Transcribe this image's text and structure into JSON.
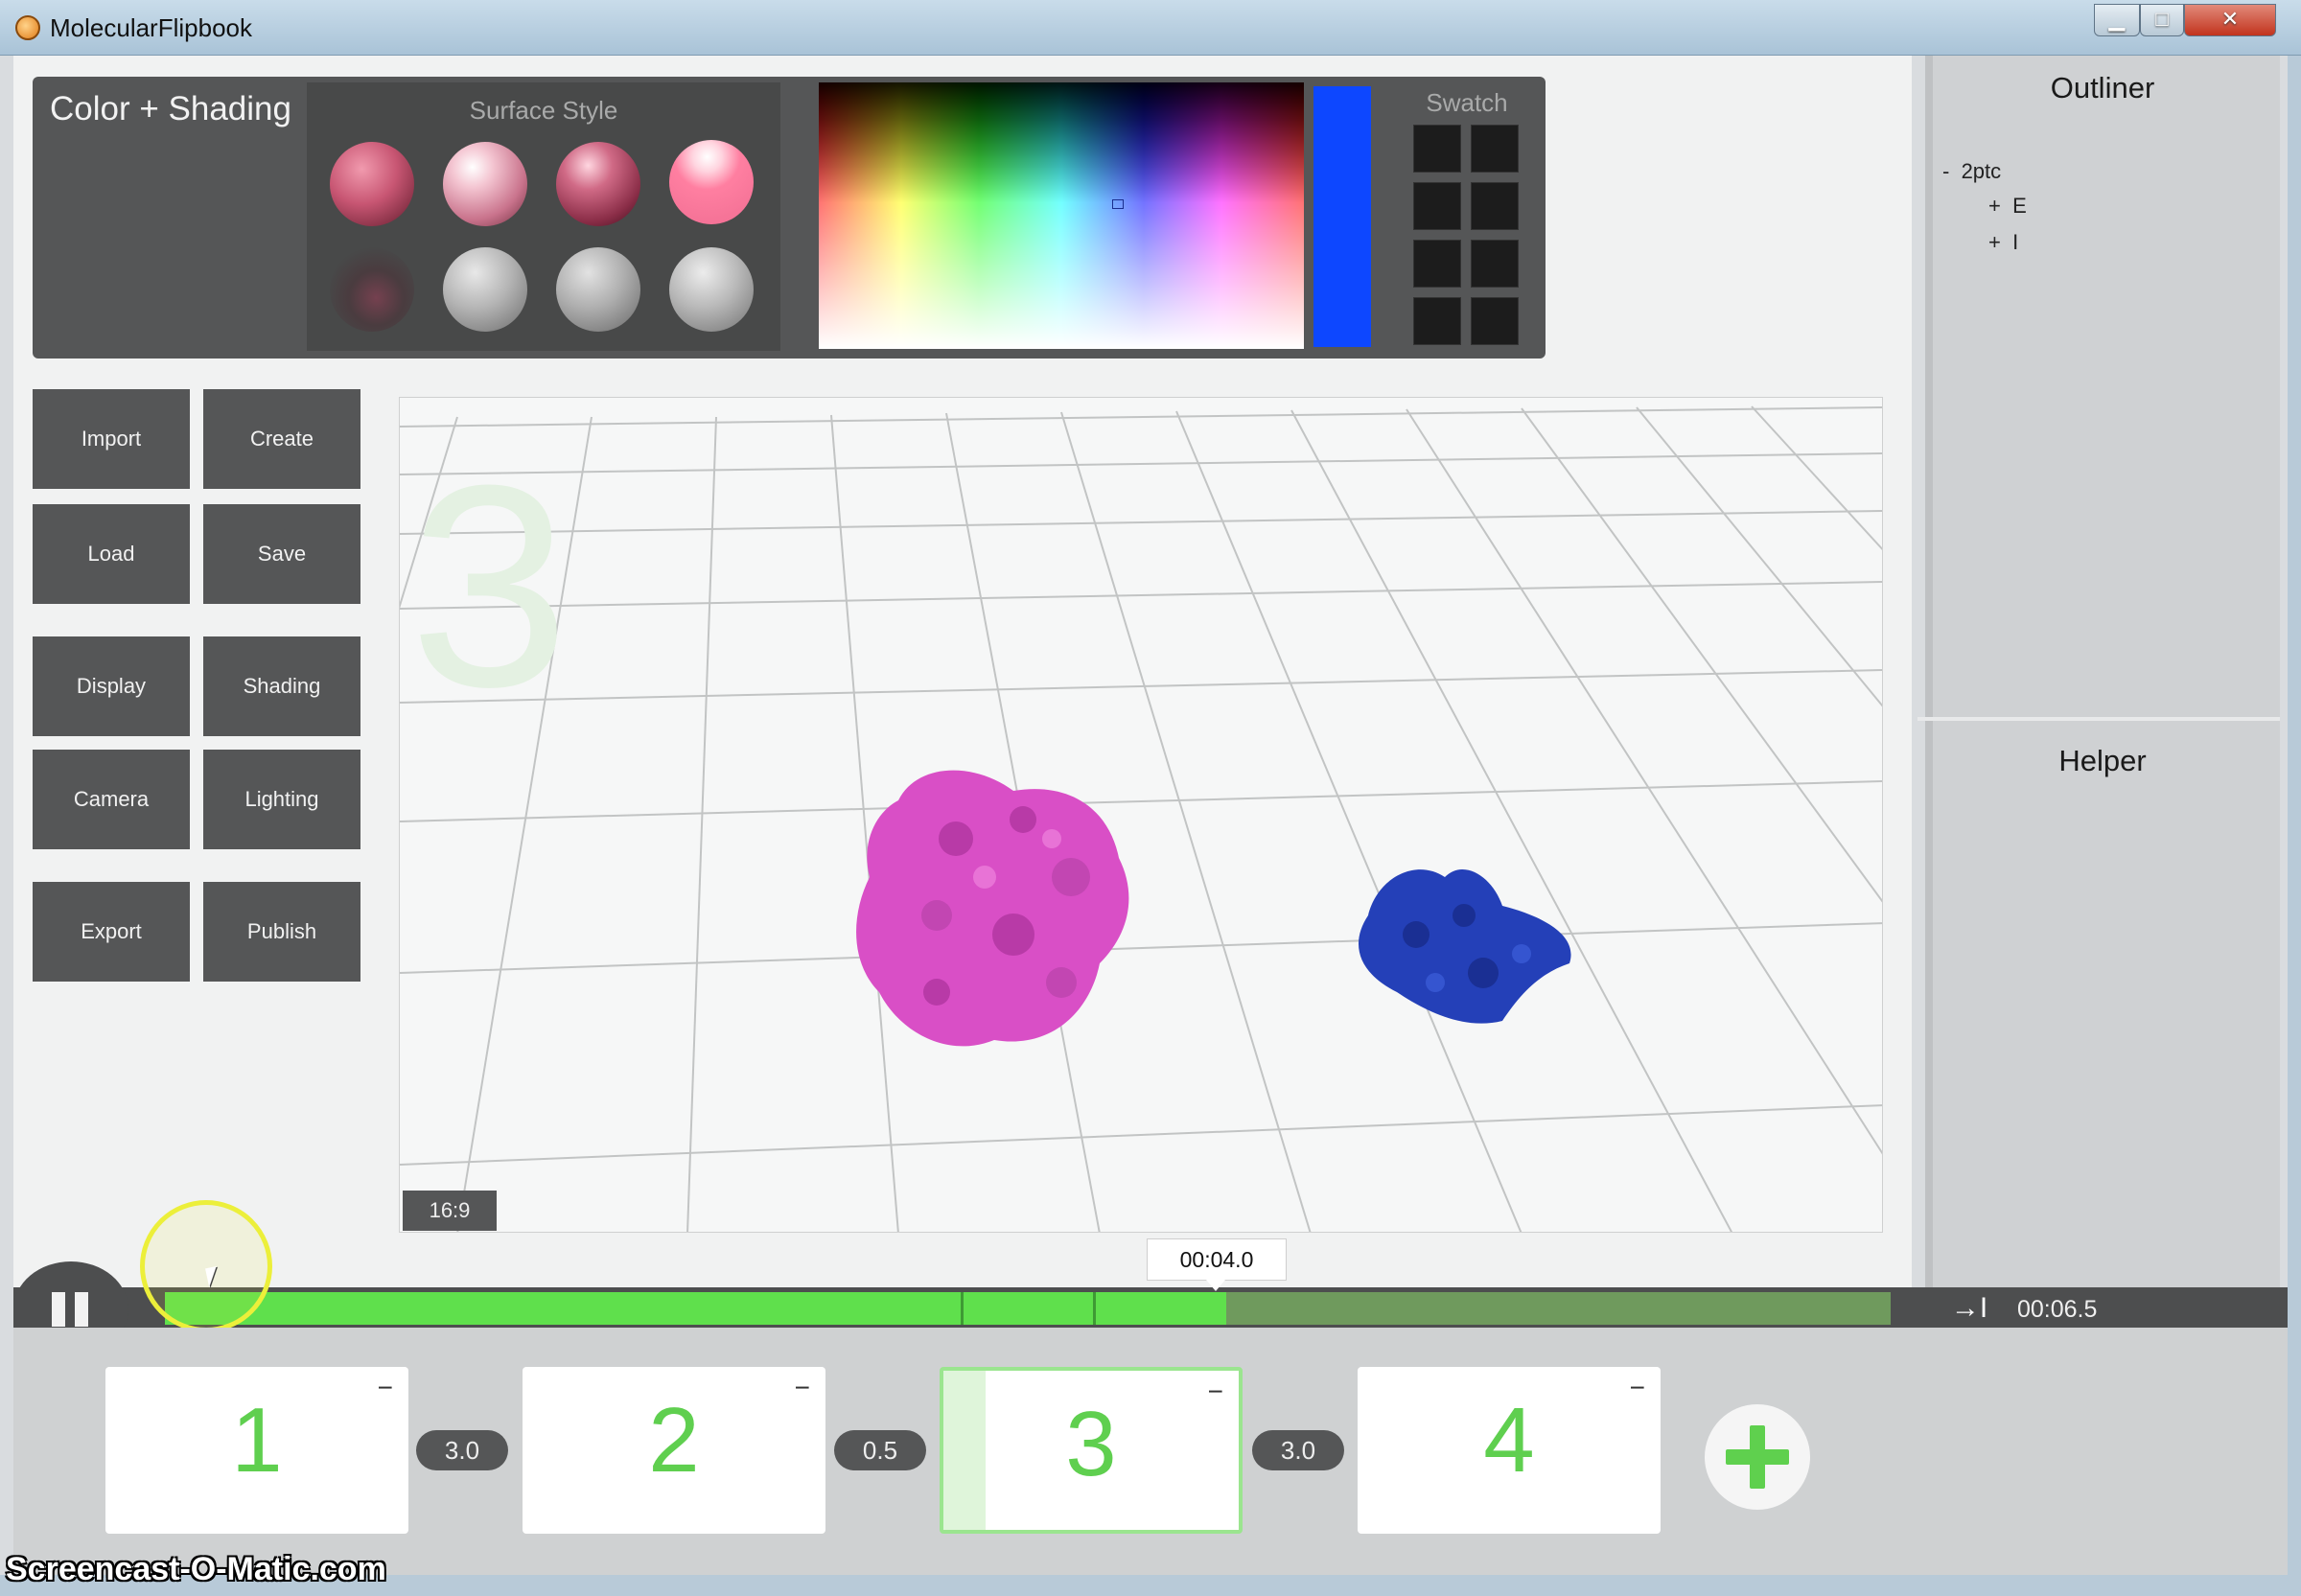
{
  "window": {
    "title": "MolecularFlipbook",
    "minimize": "▁",
    "maximize": "□",
    "close": "✕"
  },
  "color_panel": {
    "title": "Color + Shading",
    "surface_style_label": "Surface Style",
    "swatch_label": "Swatch",
    "selected_color": "#0d47ff"
  },
  "tools": {
    "import": "Import",
    "create": "Create",
    "load": "Load",
    "save": "Save",
    "display": "Display",
    "shading": "Shading",
    "camera": "Camera",
    "lighting": "Lighting",
    "export": "Export",
    "publish": "Publish"
  },
  "viewport": {
    "aspect_ratio": "16:9",
    "molecule_colors": [
      "#d94fc6",
      "#2440b8"
    ]
  },
  "outliner": {
    "title": "Outliner",
    "tree": [
      {
        "toggle": "-",
        "label": "2ptc"
      },
      {
        "toggle": "+",
        "label": "E"
      },
      {
        "toggle": "+",
        "label": "I"
      }
    ]
  },
  "helper": {
    "title": "Helper"
  },
  "timeline": {
    "current_time": "00:04.0",
    "end_time": "00:06.5",
    "progress_fraction": 0.615,
    "end_icon": "→I"
  },
  "keyframes": [
    {
      "label": "1",
      "minus": "−"
    },
    {
      "label": "2",
      "minus": "−"
    },
    {
      "label": "3",
      "minus": "−"
    },
    {
      "label": "4",
      "minus": "−"
    }
  ],
  "durations": [
    "3.0",
    "0.5",
    "3.0"
  ],
  "accent_green": "#5fcf4f",
  "watermark": "Screencast-O-Matic.com"
}
